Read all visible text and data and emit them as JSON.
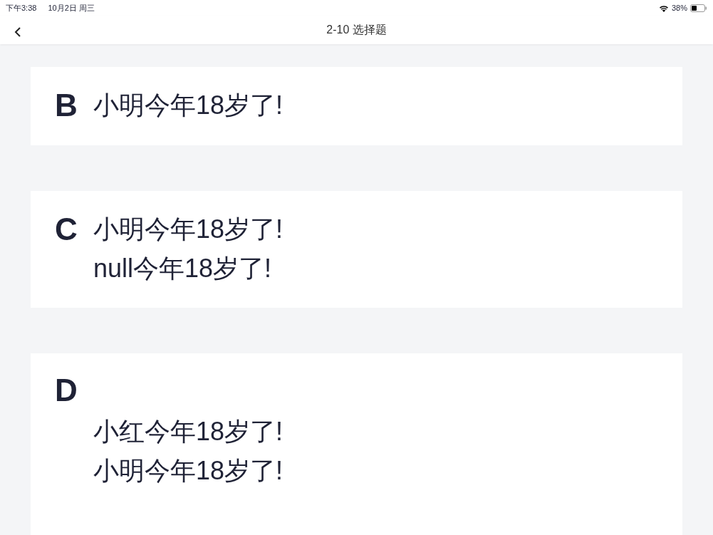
{
  "status_bar": {
    "time": "下午3:38",
    "date": "10月2日 周三",
    "battery": "38%"
  },
  "nav": {
    "title": "2-10 选择题"
  },
  "options": [
    {
      "letter": "B",
      "kind": "inline",
      "lines": [
        "小明今年18岁了!"
      ]
    },
    {
      "letter": "C",
      "kind": "inline",
      "lines": [
        "小明今年18岁了!",
        "null今年18岁了!"
      ]
    },
    {
      "letter": "D",
      "kind": "stacked",
      "lines": [
        "小红今年18岁了!",
        "小明今年18岁了!"
      ]
    }
  ]
}
